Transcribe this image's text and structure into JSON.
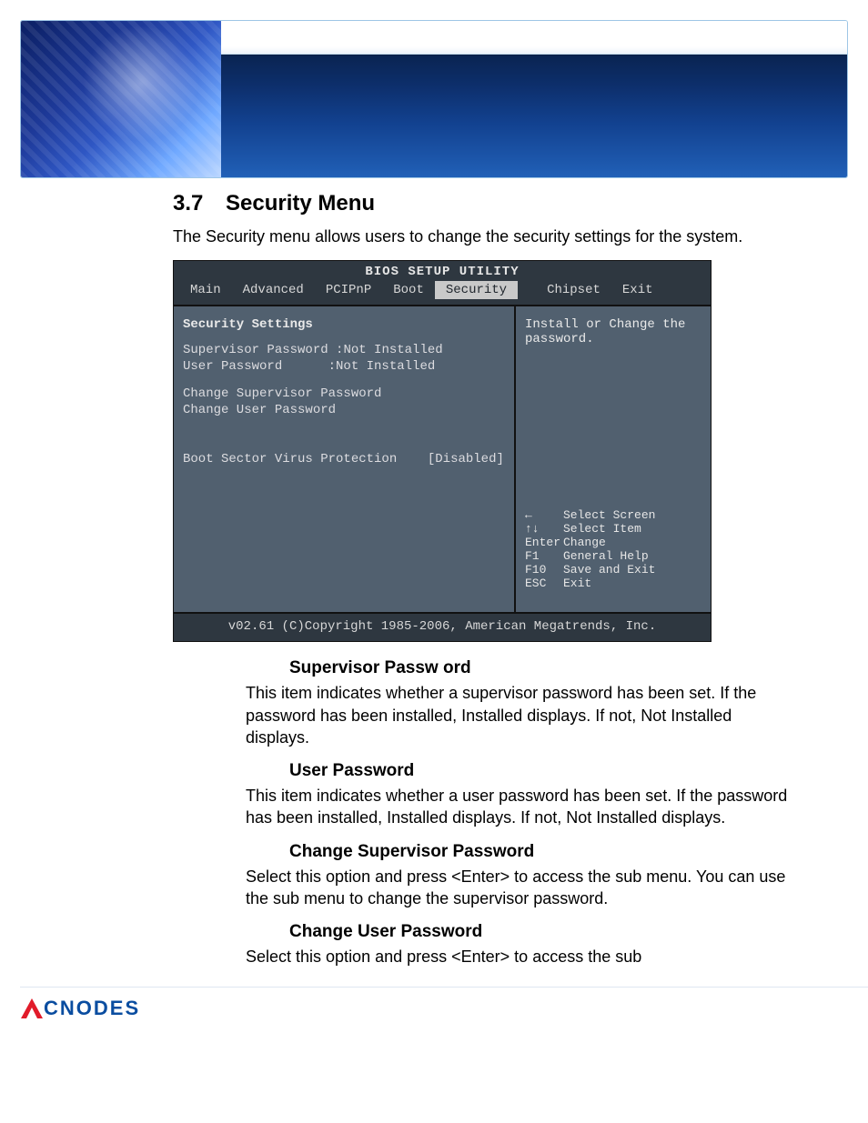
{
  "section": {
    "number": "3.7",
    "title": "Security Menu",
    "intro": "The Security menu allows users to change the security settings for the system."
  },
  "bios": {
    "title": "BIOS SETUP UTILITY",
    "tabs": [
      "Main",
      "Advanced",
      "PCIPnP",
      "Boot",
      "Security",
      "Chipset",
      "Exit"
    ],
    "active_tab_index": 4,
    "heading": "Security Settings",
    "rows": [
      {
        "label": "Supervisor Password",
        "value": ":Not Installed"
      },
      {
        "label": "User Password",
        "value": ":Not Installed"
      }
    ],
    "actions": [
      "Change Supervisor Password",
      "Change User Password"
    ],
    "option": {
      "label": "Boot Sector Virus Protection",
      "value": "[Disabled]"
    },
    "help": "Install or Change the password.",
    "keys": [
      {
        "k": "←",
        "t": "Select Screen"
      },
      {
        "k": "↑↓",
        "t": "Select Item"
      },
      {
        "k": "Enter",
        "t": "Change"
      },
      {
        "k": "F1",
        "t": "General Help"
      },
      {
        "k": "F10",
        "t": "Save and Exit"
      },
      {
        "k": "ESC",
        "t": "Exit"
      }
    ],
    "copyright": "v02.61 (C)Copyright 1985-2006, American Megatrends, Inc."
  },
  "items": [
    {
      "title": "Supervisor Passw ord",
      "body": "This item indicates whether a supervisor password has been set. If the password has been installed, Installed displays. If not, Not Installed displays."
    },
    {
      "title": "User Password",
      "body": "This item indicates whether a user password has been set. If the password has been installed, Installed displays. If not,  Not Installed displays."
    },
    {
      "title": "Change Supervisor Password",
      "body": "Select this option and press <Enter> to access the sub menu. You can use the sub menu to change the supervisor password."
    },
    {
      "title": "Change User Password",
      "body": "Select this option and press <Enter> to access the sub"
    }
  ],
  "brand": "CNODES"
}
